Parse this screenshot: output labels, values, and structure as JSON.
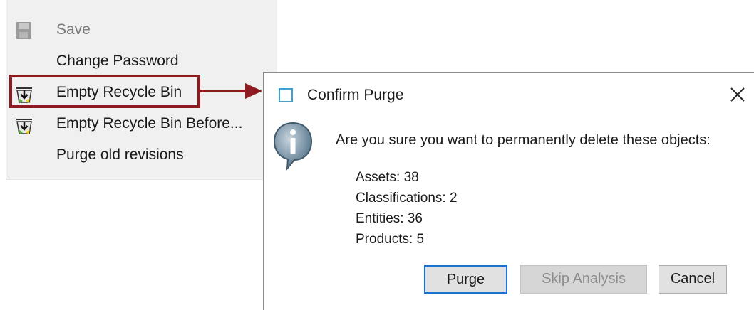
{
  "menu": {
    "items": [
      {
        "label": "Save",
        "icon": "floppy-disk-icon",
        "enabled": false
      },
      {
        "label": "Change Password",
        "icon": "",
        "enabled": true
      },
      {
        "label": "Empty Recycle Bin",
        "icon": "recycle-bin-icon",
        "enabled": true,
        "highlighted": true
      },
      {
        "label": "Empty Recycle Bin Before...",
        "icon": "recycle-bin-icon",
        "enabled": true
      },
      {
        "label": "Purge old revisions",
        "icon": "",
        "enabled": true
      }
    ]
  },
  "annotation": {
    "highlight_color": "#8e1b22"
  },
  "dialog": {
    "title": "Confirm Purge",
    "close_icon": "close-icon",
    "info_icon": "info-icon",
    "message": "Are you sure you want to permanently delete these objects:",
    "counts": [
      "Assets: 38",
      "Classifications: 2",
      "Entities: 36",
      "Products: 5"
    ],
    "buttons": {
      "purge": "Purge",
      "skip_analysis": "Skip Analysis",
      "cancel": "Cancel"
    }
  }
}
